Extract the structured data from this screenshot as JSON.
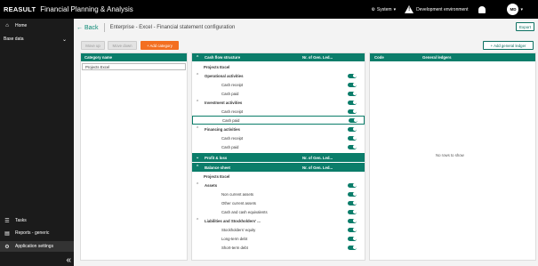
{
  "topbar": {
    "brand": "REASULT",
    "app_title": "Financial Planning & Analysis",
    "system_label": "System",
    "env_label": "Development environment",
    "user_initials": "MD"
  },
  "sidebar": {
    "items": [
      {
        "label": "Home",
        "icon": "home-icon"
      },
      {
        "label": "Base data",
        "icon": "none"
      }
    ],
    "bottom_items": [
      {
        "label": "Tasks",
        "icon": "tasks-icon"
      },
      {
        "label": "Reports - generic",
        "icon": "reports-icon"
      },
      {
        "label": "Application settings",
        "icon": "gear-icon"
      }
    ]
  },
  "header": {
    "back_label": "Back",
    "breadcrumb": "Enterprise - Excel - Financial statement configuration",
    "export_label": "Export"
  },
  "toolbar": {
    "move_up": "Move up",
    "move_down": "Move down",
    "add_category": "+ Add category",
    "add_general_ledger": "+ Add general ledger"
  },
  "category_panel": {
    "header": "Category name",
    "items": [
      "Projects Excel"
    ]
  },
  "structure_panel": {
    "groups": [
      {
        "title": "Cash flow structure",
        "count_header": "Nr. of Gen. Led..."
      },
      {
        "title": "Profit & loss",
        "count_header": "Nr. of Gen. Led..."
      },
      {
        "title": "Balance sheet",
        "count_header": "Nr. of Gen. Led..."
      }
    ],
    "cashflow_rows": [
      {
        "label": "Projects Excel",
        "level": 0,
        "bold": true,
        "chev": false
      },
      {
        "label": "Operational activities",
        "level": 1,
        "bold": true,
        "chev": true
      },
      {
        "label": "Cash receipt",
        "level": 2,
        "bold": false,
        "chev": false
      },
      {
        "label": "Cash paid",
        "level": 2,
        "bold": false,
        "chev": false
      },
      {
        "label": "Investment activities",
        "level": 1,
        "bold": true,
        "chev": true
      },
      {
        "label": "Cash receipt",
        "level": 2,
        "bold": false,
        "chev": false
      },
      {
        "label": "Cash paid",
        "level": 2,
        "bold": false,
        "chev": false,
        "selected": true
      },
      {
        "label": "Financing activities",
        "level": 1,
        "bold": true,
        "chev": true
      },
      {
        "label": "Cash receipt",
        "level": 2,
        "bold": false,
        "chev": false
      },
      {
        "label": "Cash paid",
        "level": 2,
        "bold": false,
        "chev": false
      }
    ],
    "balance_rows": [
      {
        "label": "Projects Excel",
        "level": 0,
        "bold": true,
        "chev": false
      },
      {
        "label": "Assets",
        "level": 1,
        "bold": true,
        "chev": true
      },
      {
        "label": "Non current assets",
        "level": 2,
        "bold": false,
        "chev": false
      },
      {
        "label": "Other current assets",
        "level": 2,
        "bold": false,
        "chev": false
      },
      {
        "label": "Cash and cash equivalents",
        "level": 2,
        "bold": false,
        "chev": false
      },
      {
        "label": "Liabilities and Stockholders' ...",
        "level": 1,
        "bold": true,
        "chev": true
      },
      {
        "label": "Stockholders' equity",
        "level": 2,
        "bold": false,
        "chev": false
      },
      {
        "label": "Long-term debt",
        "level": 2,
        "bold": false,
        "chev": false
      },
      {
        "label": "Short-term debt",
        "level": 2,
        "bold": false,
        "chev": false
      }
    ]
  },
  "ledger_panel": {
    "col_code": "Code",
    "col_ledgers": "General ledgers",
    "empty_text": "No rows to show"
  }
}
